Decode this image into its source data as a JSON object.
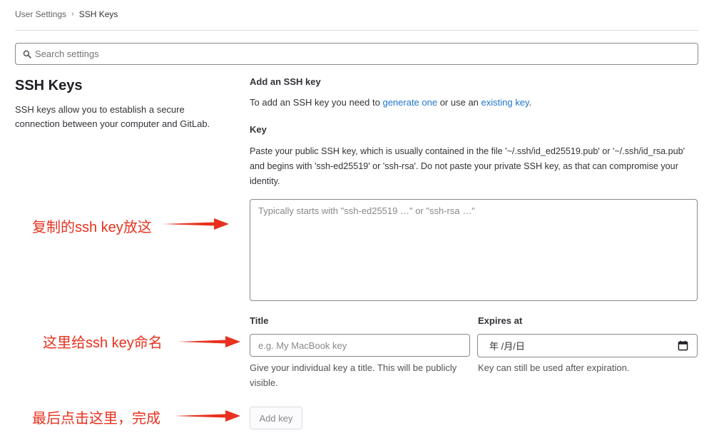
{
  "breadcrumb": {
    "parent": "User Settings",
    "current": "SSH Keys"
  },
  "search": {
    "placeholder": "Search settings"
  },
  "section": {
    "title": "SSH Keys",
    "description": "SSH keys allow you to establish a secure connection between your computer and GitLab."
  },
  "form": {
    "heading": "Add an SSH key",
    "intro_prefix": "To add an SSH key you need to ",
    "generate_link": "generate one",
    "intro_middle": " or use an ",
    "existing_link": "existing key",
    "intro_suffix": ".",
    "key_label": "Key",
    "key_help": "Paste your public SSH key, which is usually contained in the file '~/.ssh/id_ed25519.pub' or '~/.ssh/id_rsa.pub' and begins with 'ssh-ed25519' or 'ssh-rsa'. Do not paste your private SSH key, as that can compromise your identity.",
    "key_placeholder": "Typically starts with \"ssh-ed25519 …\" or \"ssh-rsa …\"",
    "title_label": "Title",
    "title_placeholder": "e.g. My MacBook key",
    "title_help": "Give your individual key a title. This will be publicly visible.",
    "expires_label": "Expires at",
    "expires_value": "年 /月/日",
    "expires_help": "Key can still be used after expiration.",
    "submit_label": "Add key"
  },
  "annotations": {
    "key_note": "复制的ssh key放这",
    "title_note": "这里给ssh key命名",
    "submit_note": "最后点击这里，完成"
  },
  "colors": {
    "annotation": "#e8321f",
    "link": "#1f75cb"
  },
  "icons": {
    "search": "search-icon",
    "calendar": "calendar-icon",
    "breadcrumb_sep": "chevron-right-icon"
  }
}
